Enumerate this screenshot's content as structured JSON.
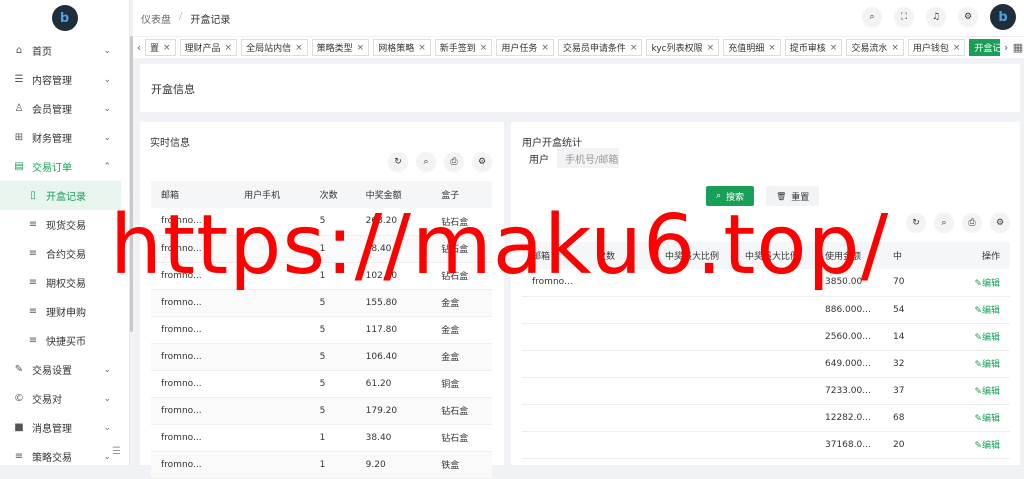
{
  "sidebar": {
    "logo": "b",
    "items": [
      {
        "label": "首页",
        "icon": "home-icon",
        "glyph": "⌂",
        "chev": "⌄"
      },
      {
        "label": "内容管理",
        "icon": "list-icon",
        "glyph": "☰",
        "chev": "⌄"
      },
      {
        "label": "会员管理",
        "icon": "user-icon",
        "glyph": "♙",
        "chev": "⌄"
      },
      {
        "label": "财务管理",
        "icon": "finance-icon",
        "glyph": "⊞",
        "chev": "⌄"
      },
      {
        "label": "交易订单",
        "icon": "order-icon",
        "glyph": "▤",
        "chev": "⌃"
      }
    ],
    "subitems": [
      {
        "label": "开盒记录",
        "glyph": "▯"
      },
      {
        "label": "现货交易",
        "glyph": "≡"
      },
      {
        "label": "合约交易",
        "glyph": "≡"
      },
      {
        "label": "期权交易",
        "glyph": "≡"
      },
      {
        "label": "理财申购",
        "glyph": "≡"
      },
      {
        "label": "快捷买币",
        "glyph": "≡"
      }
    ],
    "items2": [
      {
        "label": "交易设置",
        "glyph": "✎",
        "chev": "⌄"
      },
      {
        "label": "交易对",
        "glyph": "©",
        "chev": "⌄"
      },
      {
        "label": "消息管理",
        "glyph": "■",
        "chev": "⌄"
      },
      {
        "label": "策略交易",
        "glyph": "≡",
        "chev": "⌄"
      }
    ],
    "collapse": "☰"
  },
  "header": {
    "breadcrumb": [
      "仪表盘",
      "/",
      "开盒记录"
    ],
    "icons": [
      "search-icon",
      "fullscreen-icon",
      "bell-icon",
      "gear-icon"
    ],
    "glyphs": [
      "⌕",
      "⛶",
      "♫",
      "⚙"
    ],
    "avatar": "b"
  },
  "tabs": {
    "prev": "‹",
    "next": "›",
    "grid": "▦",
    "close": "×",
    "items": [
      "置",
      "理财产品",
      "全局站内信",
      "策略类型",
      "网格策略",
      "新手签到",
      "用户任务",
      "交易员申请条件",
      "kyc列表权限",
      "充值明细",
      "提币审核",
      "交易流水",
      "用户钱包",
      "开盒记录"
    ]
  },
  "page_title": "开盒信息",
  "left_panel": {
    "title": "实时信息",
    "tool_glyphs": [
      "↻",
      "⌕",
      "⎙",
      "⚙"
    ],
    "columns": [
      "邮箱",
      "用户手机",
      "次数",
      "中奖金额",
      "盒子"
    ],
    "rows": [
      [
        "fromno...",
        "",
        "5",
        "268.20",
        "钻石盒"
      ],
      [
        "fromno...",
        "",
        "1",
        "38.40",
        "钻石盒"
      ],
      [
        "fromno...",
        "",
        "1",
        "102.40",
        "钻石盒"
      ],
      [
        "fromno...",
        "",
        "5",
        "155.80",
        "金盒"
      ],
      [
        "fromno...",
        "",
        "5",
        "117.80",
        "金盒"
      ],
      [
        "fromno...",
        "",
        "5",
        "106.40",
        "金盒"
      ],
      [
        "fromno...",
        "",
        "5",
        "61.20",
        "铜盒"
      ],
      [
        "fromno...",
        "",
        "5",
        "179.20",
        "钻石盒"
      ],
      [
        "fromno...",
        "",
        "1",
        "38.40",
        "钻石盒"
      ],
      [
        "fromno...",
        "",
        "1",
        "9.20",
        "铁盒"
      ]
    ]
  },
  "right_panel": {
    "title": "用户开盒统计",
    "filter_label": "用户",
    "filter_placeholder": "手机号/邮箱",
    "search_label": "搜索",
    "search_glyph": "⌕",
    "reset_label": "重置",
    "reset_glyph": "🗑",
    "tool_glyphs": [
      "↻",
      "⌕",
      "⎙",
      "⚙"
    ],
    "columns": [
      "邮箱",
      "次数",
      "中奖最大比例",
      "中奖最大比例",
      "使用金额",
      "中",
      "操作"
    ],
    "rows": [
      {
        "email": "fromno...",
        "amount": "3850.00",
        "extra": "70",
        "action": "编辑"
      },
      {
        "email": "",
        "amount": "886.000...",
        "extra": "54",
        "action": "编辑"
      },
      {
        "email": "",
        "amount": "2560.00...",
        "extra": "14",
        "action": "编辑"
      },
      {
        "email": "",
        "amount": "649.000...",
        "extra": "32",
        "action": "编辑"
      },
      {
        "email": "",
        "amount": "7233.00...",
        "extra": "37",
        "action": "编辑"
      },
      {
        "email": "",
        "amount": "12282.0...",
        "extra": "68",
        "action": "编辑"
      },
      {
        "email": "",
        "amount": "37168.0...",
        "extra": "20",
        "action": "编辑"
      }
    ],
    "edit_glyph": "✎"
  },
  "watermark": "https://maku6.top/",
  "colors": {
    "accent": "#18a058",
    "watermark": "#ff0000"
  }
}
